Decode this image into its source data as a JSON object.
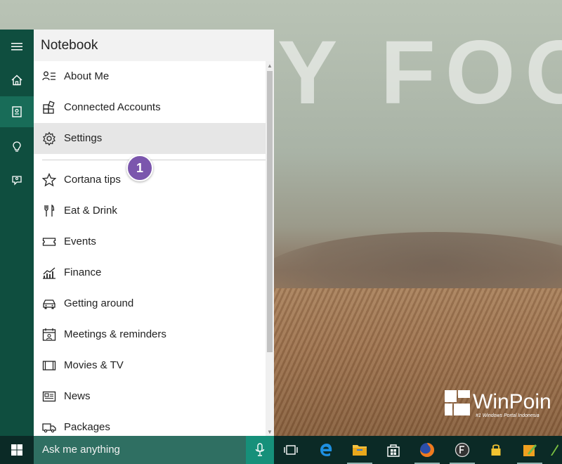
{
  "wallpaper": {
    "overlay_text": "Y FOO",
    "watermark": {
      "title": "WinPoin",
      "subtitle": "#1 Windows Portal Indonesia"
    }
  },
  "rail": {
    "items": [
      {
        "name": "hamburger-icon"
      },
      {
        "name": "home-icon"
      },
      {
        "name": "notebook-icon",
        "active": true
      },
      {
        "name": "lightbulb-icon"
      },
      {
        "name": "feedback-icon"
      }
    ]
  },
  "notebook": {
    "title": "Notebook",
    "items": [
      {
        "label": "About Me",
        "icon": "about-me-icon"
      },
      {
        "label": "Connected Accounts",
        "icon": "connected-accounts-icon"
      },
      {
        "label": "Settings",
        "icon": "gear-icon",
        "highlighted": true
      },
      {
        "label": "Cortana tips",
        "icon": "star-icon"
      },
      {
        "label": "Eat & Drink",
        "icon": "fork-knife-icon"
      },
      {
        "label": "Events",
        "icon": "ticket-icon"
      },
      {
        "label": "Finance",
        "icon": "chart-icon"
      },
      {
        "label": "Getting around",
        "icon": "car-icon"
      },
      {
        "label": "Meetings & reminders",
        "icon": "calendar-icon"
      },
      {
        "label": "Movies & TV",
        "icon": "film-icon"
      },
      {
        "label": "News",
        "icon": "newspaper-icon"
      },
      {
        "label": "Packages",
        "icon": "truck-icon"
      }
    ],
    "step_badge": "1"
  },
  "taskbar": {
    "search_placeholder": "Ask me anything",
    "icons": [
      "start-icon",
      "microphone-icon",
      "task-view-icon",
      "edge-icon",
      "file-explorer-icon",
      "store-icon",
      "firefox-icon",
      "f-app-icon",
      "lock-icon",
      "paint-icon",
      "green-app-icon"
    ]
  },
  "colors": {
    "rail": "#0f4e3f",
    "rail_active": "#186c58",
    "taskbar": "#0b2a26",
    "searchbox": "#2f6f62",
    "mic": "#16907a",
    "badge": "#7b56ad",
    "highlight": "#e6e6e6"
  }
}
